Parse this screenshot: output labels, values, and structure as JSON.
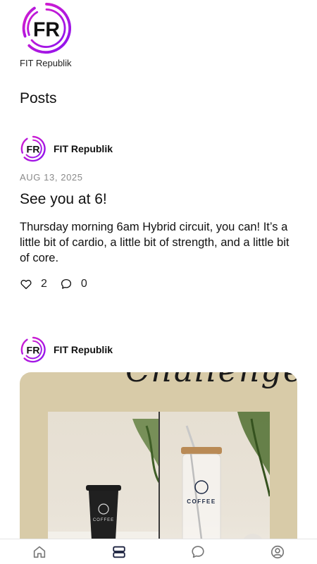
{
  "app": {
    "brand_name": "FIT Republik",
    "logo_letters": "FR",
    "accent_color": "#c21bd6",
    "accent_color_2": "#8a12f0"
  },
  "page": {
    "section_title": "Posts"
  },
  "posts": [
    {
      "author": "FIT Republik",
      "date": "AUG 13, 2025",
      "title": "See you at 6!",
      "body": "Thursday morning 6am Hybrid circuit, you can! It’s a little bit of cardio, a little bit of strength, and a little bit of core.",
      "likes": "2",
      "comments": "0"
    },
    {
      "author": "FIT Republik",
      "image_script_text": "Challenge",
      "product_label": "COFFEE"
    }
  ],
  "bottom_nav": {
    "items": [
      {
        "icon": "home-icon"
      },
      {
        "icon": "posts-icon",
        "active": true
      },
      {
        "icon": "chat-icon"
      },
      {
        "icon": "profile-icon"
      }
    ]
  }
}
